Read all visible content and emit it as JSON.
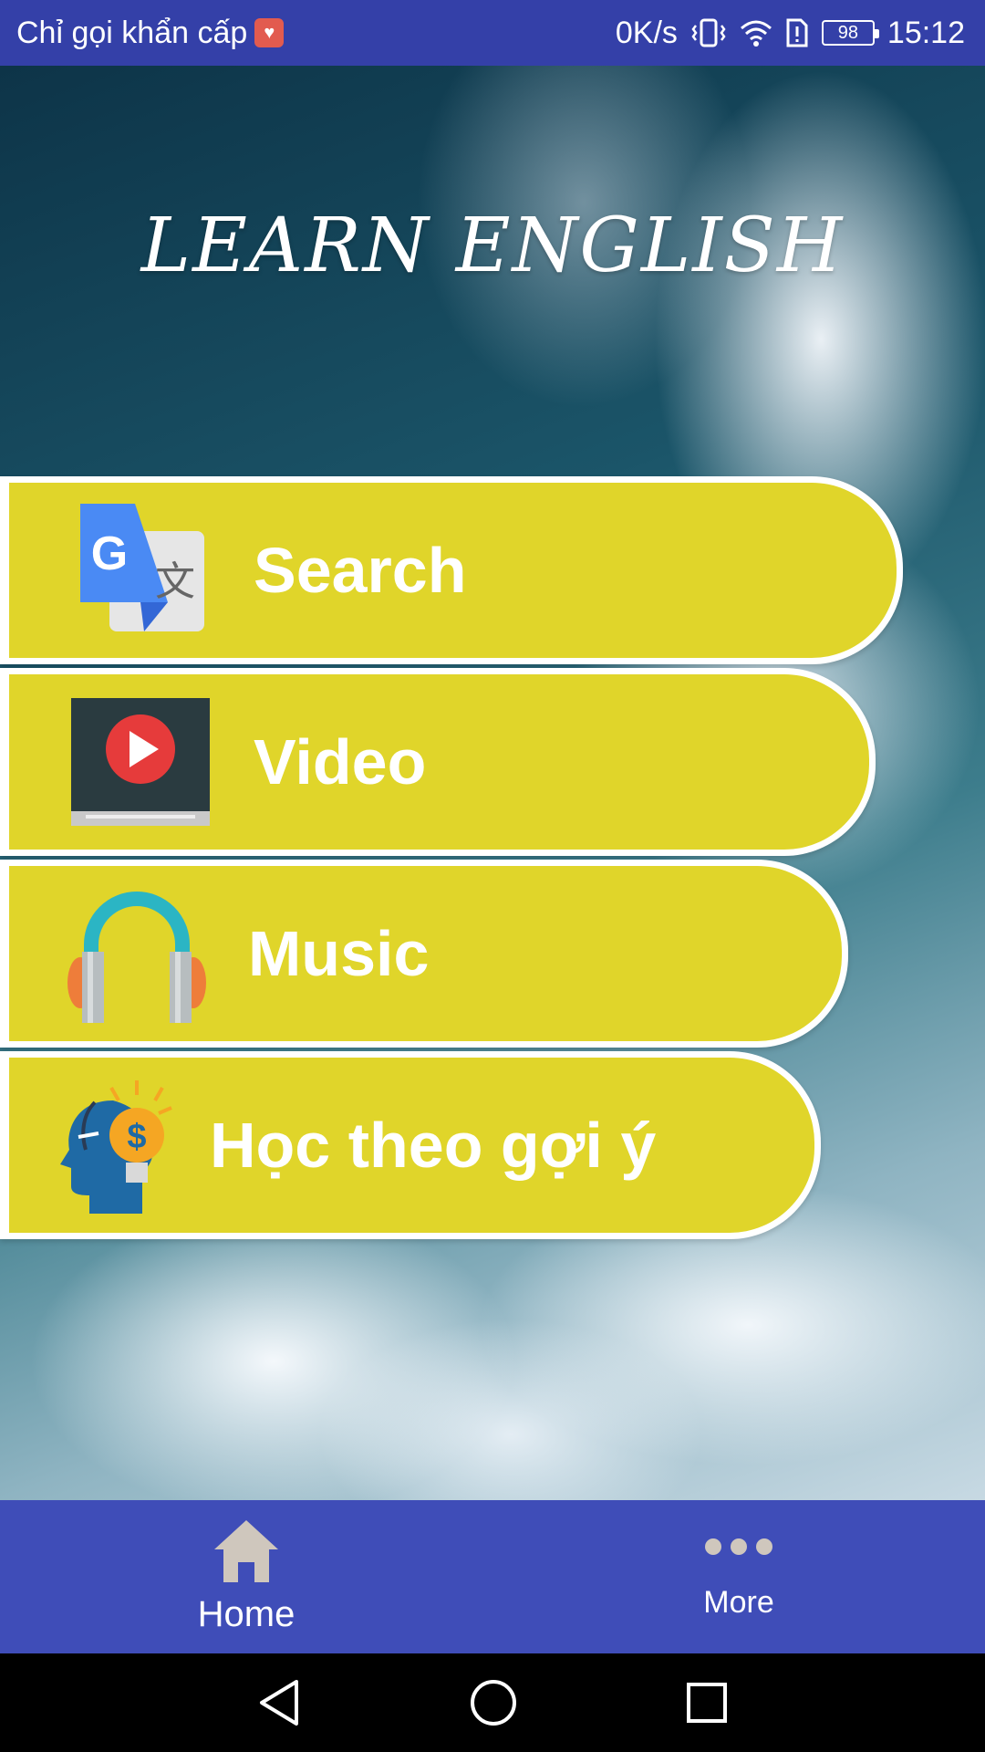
{
  "status_bar": {
    "carrier_text": "Chỉ gọi khẩn cấp",
    "net_speed": "0K/s",
    "battery": "98",
    "time": "15:12",
    "icons": [
      "heart-badge-icon",
      "vibrate-icon",
      "wifi-icon",
      "alert-icon",
      "battery-icon"
    ]
  },
  "header": {
    "title": "LEARN ENGLISH"
  },
  "menu": {
    "items": [
      {
        "label": "Search",
        "icon": "google-translate-icon"
      },
      {
        "label": "Video",
        "icon": "video-play-icon"
      },
      {
        "label": "Music",
        "icon": "headphones-icon"
      },
      {
        "label": "Học theo gợi ý",
        "icon": "idea-head-icon"
      }
    ]
  },
  "bottom_nav": {
    "home_label": "Home",
    "more_label": "More",
    "active": "Home"
  },
  "system_nav": {
    "icons": [
      "back-icon",
      "home-circle-icon",
      "recents-icon"
    ]
  },
  "colors": {
    "status_bar": "#3440a8",
    "bottom_nav": "#3f4db8",
    "menu_pill": "#e0d52a",
    "text_light": "#ffffff"
  }
}
